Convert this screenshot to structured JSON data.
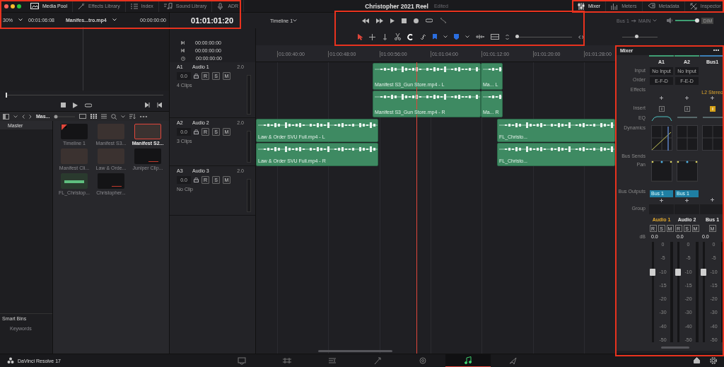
{
  "toolbar_left": {
    "tabs": [
      {
        "label": "Media Pool",
        "selected": true
      },
      {
        "label": "Effects Library",
        "selected": false
      },
      {
        "label": "Index",
        "selected": false
      },
      {
        "label": "Sound Library",
        "selected": false
      },
      {
        "label": "ADR",
        "selected": false
      }
    ]
  },
  "project": {
    "title": "Christopher 2021 Reel",
    "status": "Edited"
  },
  "toolbar_right": {
    "tabs": [
      {
        "label": "Mixer",
        "selected": true
      },
      {
        "label": "Meters",
        "selected": false
      },
      {
        "label": "Metadata",
        "selected": false
      },
      {
        "label": "Inspector",
        "selected": false
      }
    ]
  },
  "viewer": {
    "zoom": "30%",
    "duration": "00:01:06:08",
    "clip": "Manifes...tro.mp4",
    "timecode": "00:00:00:00"
  },
  "timeline_header": {
    "timecode": "01:01:01:20",
    "timeline": "Timeline 1",
    "zoom": {
      "level": 0.0
    }
  },
  "track_zoom": {
    "level": 0.4
  },
  "routing": {
    "source": "Bus 1",
    "destination": "MAIN",
    "volume": {
      "level": 0.9
    },
    "dim": "DIM"
  },
  "media_pool": {
    "bin": "Mas...",
    "bins": [
      {
        "label": "Master",
        "selected": true
      }
    ],
    "smart_bins": {
      "title": "Smart Bins",
      "items": [
        "Keywords"
      ]
    },
    "clips": [
      {
        "label": "Timeline 1",
        "kind": "timeline",
        "selected": false
      },
      {
        "label": "Manifest S3...",
        "kind": "video",
        "selected": false
      },
      {
        "label": "Manifest S2...",
        "kind": "video",
        "selected": true
      },
      {
        "label": "Manifest Cli...",
        "kind": "video",
        "selected": false
      },
      {
        "label": "Law & Orde...",
        "kind": "video",
        "selected": false
      },
      {
        "label": "Juniper Clip...",
        "kind": "audio",
        "selected": false
      },
      {
        "label": "FL_Christop...",
        "kind": "waveform",
        "selected": false
      },
      {
        "label": "Christopher...",
        "kind": "audio",
        "selected": false
      }
    ]
  },
  "track_timecodes": [
    "00:00:00:00",
    "00:00:00:00",
    "00:00:00:00"
  ],
  "ruler": [
    "01:00:40:00",
    "01:00:48:00",
    "01:00:56:00",
    "01:01:04:00",
    "01:01:12:00",
    "01:01:20:00",
    "01:01:28:00"
  ],
  "tracks": [
    {
      "id": "A1",
      "name": "Audio 1",
      "format": "2.0",
      "volume": "0.0",
      "buttons": [
        "R",
        "S",
        "M"
      ],
      "info": "4 Clips",
      "lanes": [
        [
          "Manifest S3_Gun Store.mp4 - L",
          "Ma... L"
        ],
        [
          "Manifest S3_Gun Store.mp4 - R",
          "Ma... R"
        ]
      ]
    },
    {
      "id": "A2",
      "name": "Audio 2",
      "format": "2.0",
      "volume": "0.0",
      "buttons": [
        "R",
        "S",
        "M"
      ],
      "info": "3 Clips",
      "lanes": [
        [
          "Law & Order SVU Full.mp4 - L",
          "FL_Christo..."
        ],
        [
          "Law & Order SVU Full.mp4 - R",
          "FL_Christo..."
        ]
      ]
    },
    {
      "id": "A3",
      "name": "Audio 3",
      "format": "2.0",
      "volume": "0.0",
      "buttons": [
        "R",
        "S",
        "M"
      ],
      "info": "No Clip"
    }
  ],
  "mixer": {
    "title": "Mixer",
    "row_labels": [
      "Input",
      "Order",
      "Effects",
      "Insert",
      "EQ",
      "Dynamics",
      "Bus Sends",
      "Pan",
      "Bus Outputs",
      "Group",
      "dB"
    ],
    "strips": [
      {
        "id": "A1",
        "kind": "audio",
        "color": "#3f9e73",
        "input": "No Input",
        "order": "E-F-D",
        "insert": false,
        "bus_output": "Bus 1",
        "name": "Audio 1",
        "selected": true,
        "buttons": [
          "R",
          "S",
          "M"
        ],
        "gain": "0.0",
        "scale": [
          "0",
          "-5",
          "-10",
          "-15",
          "-20",
          "-30",
          "-40",
          "-50"
        ],
        "fader": {
          "level": 0.7
        }
      },
      {
        "id": "A2",
        "kind": "audio",
        "color": "#3f9e73",
        "input": "No Input",
        "order": "F-E-D",
        "insert": false,
        "bus_output": "Bus 1",
        "name": "Audio 2",
        "selected": false,
        "buttons": [
          "R",
          "S",
          "M"
        ],
        "gain": "0.0",
        "scale": [
          "0",
          "-5",
          "-10",
          "-15",
          "-20",
          "-30",
          "-40",
          "-50"
        ],
        "fader": {
          "level": 0.7
        }
      },
      {
        "id": "Bus1",
        "kind": "bus",
        "color": "#3b7fb5",
        "effect": "L2 Stereo",
        "insert": true,
        "name": "Bus 1",
        "selected": false,
        "buttons": [
          "M"
        ],
        "gain": "0.0",
        "scale": [
          "0",
          "-5",
          "-10",
          "-15",
          "-20",
          "-30",
          "-40",
          "-50"
        ],
        "fader": {
          "level": 0.7
        }
      }
    ]
  },
  "bottom_bar": {
    "app": "DaVinci Resolve 17",
    "pages": [
      {
        "selected": false
      },
      {
        "selected": false
      },
      {
        "selected": false
      },
      {
        "selected": false
      },
      {
        "selected": false
      },
      {
        "selected": true
      },
      {
        "selected": false
      }
    ]
  }
}
